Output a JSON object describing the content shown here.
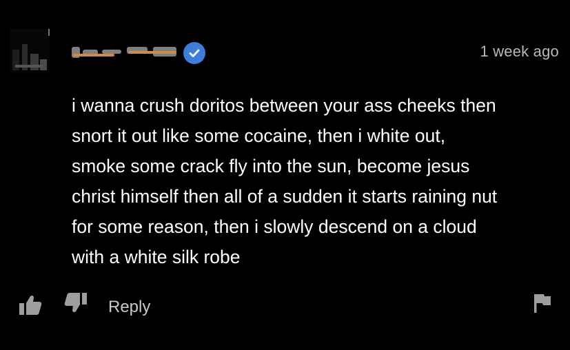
{
  "comment": {
    "timestamp": "1 week ago",
    "lines": [
      "i wanna crush doritos between your ass cheeks then",
      "snort it out like some cocaine, then i white out,",
      "smoke some crack fly into the sun, become jesus",
      "christ himself then all of a sudden it starts raining nut",
      "for some reason, then i slowly descend on a cloud",
      "with a white silk robe"
    ]
  },
  "actions": {
    "reply_label": "Reply"
  },
  "colors": {
    "background": "#000000",
    "verified_badge": "#3b7fdb",
    "timestamp_text": "#b9b9b9",
    "icon_gray": "#9e9e9e"
  },
  "icons": [
    "verified-badge-icon",
    "thumbs-up-icon",
    "thumbs-down-icon",
    "flag-icon"
  ]
}
